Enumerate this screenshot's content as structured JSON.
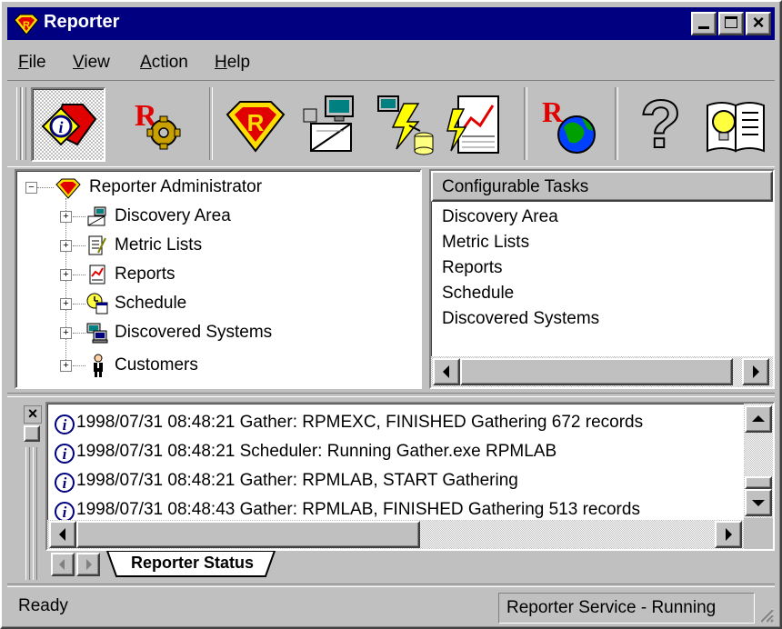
{
  "window": {
    "title": "Reporter"
  },
  "titlebar_buttons": {
    "minimize": "_",
    "maximize": "□",
    "close": "×"
  },
  "menu": [
    {
      "label": "File",
      "accel": "F"
    },
    {
      "label": "View",
      "accel": "V"
    },
    {
      "label": "Action",
      "accel": "A"
    },
    {
      "label": "Help",
      "accel": "H"
    }
  ],
  "toolbar": {
    "buttons": [
      "reporter-info-icon",
      "reporter-configure-icon",
      "reporter-logo-icon",
      "discovery-icon",
      "gather-database-icon",
      "report-chart-icon",
      "reporter-web-icon",
      "help-icon",
      "book-icon"
    ],
    "help_glyph": "?"
  },
  "tree": {
    "root": "Reporter Administrator",
    "items": [
      "Discovery Area",
      "Metric Lists",
      "Reports",
      "Schedule",
      "Discovered Systems",
      "Customers"
    ]
  },
  "tasks": {
    "header": "Configurable Tasks",
    "items": [
      "Discovery Area",
      "Metric Lists",
      "Reports",
      "Schedule",
      "Discovered Systems"
    ]
  },
  "log": {
    "entries": [
      "1998/07/31 08:48:21 Gather: RPMEXC, FINISHED Gathering 672 records",
      "1998/07/31 08:48:21 Scheduler: Running Gather.exe RPMLAB",
      "1998/07/31 08:48:21 Gather: RPMLAB, START Gathering",
      "1998/07/31 08:48:43 Gather: RPMLAB, FINISHED Gathering 513 records"
    ],
    "tab_label": "Reporter Status",
    "close_glyph": "×"
  },
  "status": {
    "left": "Ready",
    "right": "Reporter Service - Running"
  },
  "colors": {
    "titlebar": "#000080",
    "face": "#c0c0c0",
    "red": "#e00000",
    "yellow": "#ffff00"
  }
}
